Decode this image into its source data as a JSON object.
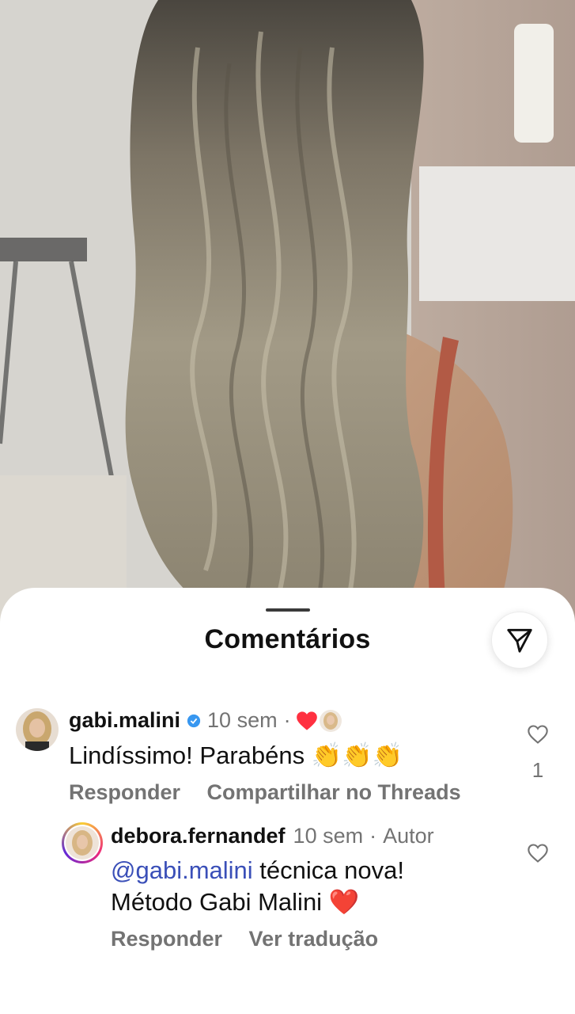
{
  "sheet": {
    "title": "Comentários"
  },
  "comments": [
    {
      "username": "gabi.malini",
      "verified": true,
      "time": "10 sem",
      "separator": "·",
      "text": "Lindíssimo! Parabéns 👏👏👏",
      "actions": [
        "Responder",
        "Compartilhar no Threads"
      ],
      "like_count": "1",
      "liked_by_author": true
    },
    {
      "username": "debora.fernandef",
      "time": "10 sem",
      "separator": "·",
      "badge": "Autor",
      "mention": "@gabi.malini",
      "text_line1_rest": " técnica nova!",
      "text_line2": "Método Gabi Malini ❤️",
      "actions": [
        "Responder",
        "Ver tradução"
      ]
    }
  ],
  "colors": {
    "verified": "#3897f0",
    "heart": "#ff3040",
    "mention": "#3a4fb8",
    "muted": "#737373"
  },
  "icons": {
    "filter": "send-filter-icon",
    "like": "heart-outline-icon"
  }
}
